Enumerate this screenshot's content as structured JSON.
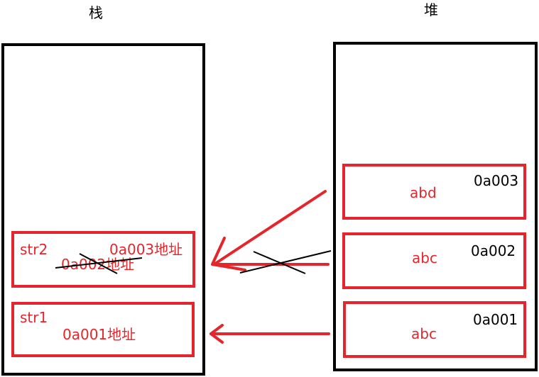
{
  "stack": {
    "title": "栈",
    "str2": {
      "name": "str2",
      "current_addr": "0a003地址",
      "old_addr": "0a002地址"
    },
    "str1": {
      "name": "str1",
      "addr": "0a001地址"
    }
  },
  "heap": {
    "title": "堆",
    "objects": [
      {
        "value": "abd",
        "addr": "0a003"
      },
      {
        "value": "abc",
        "addr": "0a002"
      },
      {
        "value": "abc",
        "addr": "0a001"
      }
    ]
  },
  "colors": {
    "reference": "#e4262c",
    "outline": "#000000"
  }
}
